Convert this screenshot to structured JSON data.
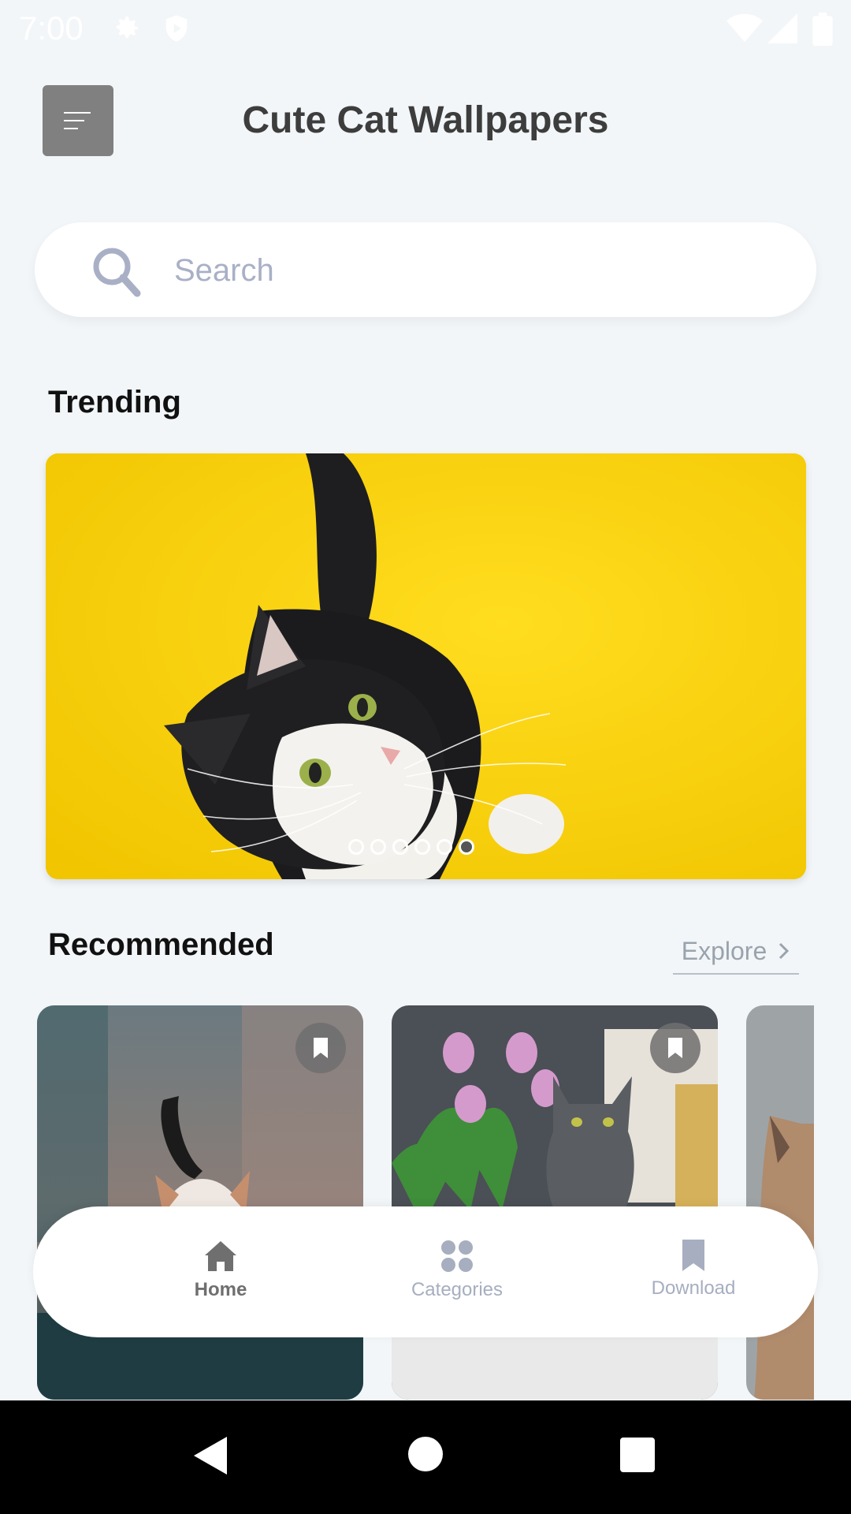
{
  "status_bar": {
    "time": "7:00",
    "icons": [
      "gear-icon",
      "shield-play-icon",
      "wifi-icon",
      "cell-signal-icon",
      "battery-icon"
    ]
  },
  "header": {
    "title": "Cute Cat Wallpapers",
    "menu_icon": "menu-icon"
  },
  "search": {
    "placeholder": "Search",
    "value": ""
  },
  "trending": {
    "title": "Trending",
    "dots_count": 6,
    "active_index": 5,
    "image": "black-and-white cat looking up on yellow background"
  },
  "recommended": {
    "title": "Recommended",
    "explore_label": "Explore",
    "cards": [
      {
        "image": "calico cat walking with tail up",
        "bookmark_icon": "bookmark-icon"
      },
      {
        "image": "gray cat beside pink tulips",
        "bookmark_icon": "bookmark-icon"
      },
      {
        "image": "fluffy cat partial"
      }
    ]
  },
  "bottom_nav": {
    "items": [
      {
        "label": "Home",
        "icon": "home-icon",
        "active": true
      },
      {
        "label": "Categories",
        "icon": "categories-icon",
        "active": false
      },
      {
        "label": "Download",
        "icon": "bookmark-icon",
        "active": false
      }
    ]
  },
  "colors": {
    "background": "#f2f6f8",
    "menu_button": "#808080",
    "trending_bg": "#f5cf08",
    "inactive_nav": "#a6aec0",
    "active_nav": "#6f6f6f"
  }
}
